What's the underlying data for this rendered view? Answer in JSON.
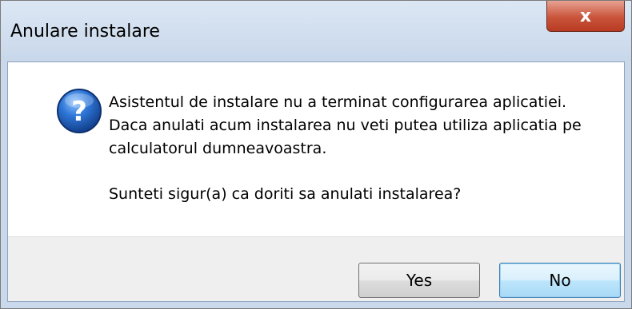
{
  "window": {
    "title": "Anulare instalare",
    "close_glyph": "x"
  },
  "dialog": {
    "icon": "question-icon",
    "message_lines": [
      "Asistentul de instalare nu a terminat configurarea aplicatiei.",
      "Daca anulati acum instalarea nu veti putea utiliza aplicatia pe",
      "calculatorul dumneavoastra."
    ],
    "question": "Sunteti sigur(a) ca doriti sa anulati instalarea?"
  },
  "buttons": {
    "yes_label": "Yes",
    "no_label": "No"
  },
  "colors": {
    "titlebar": "#c8d7ea",
    "close_button": "#c9543b",
    "icon_blue": "#1f5fbf",
    "footer": "#efefef",
    "default_button_border": "#3c7fb1"
  }
}
